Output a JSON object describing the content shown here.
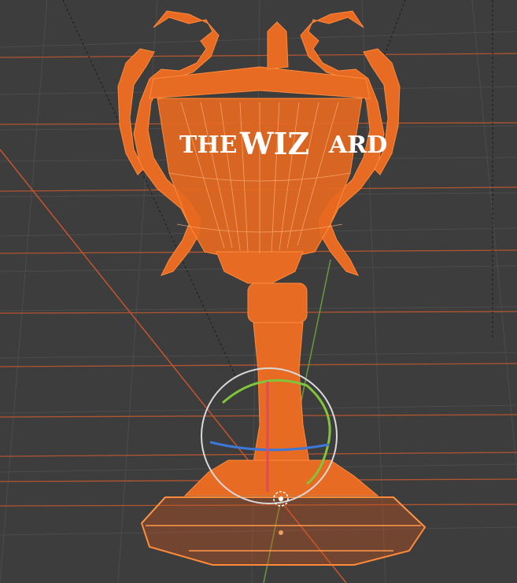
{
  "viewport": {
    "background": "#3d3d3d",
    "grid_color": "#4a4a4a",
    "x_axis_color": "#c6542e",
    "y_axis_color": "#6a9a3b",
    "selection_color": "#f26a1b"
  },
  "object": {
    "name": "trophy-cup",
    "engraving": {
      "left": "THE",
      "center": "WIZ",
      "right": "ARD"
    },
    "mode": "wireframe-selected"
  },
  "gizmo": {
    "type": "rotate",
    "ring_colors": {
      "x": "#e04a5c",
      "y": "#7fc63b",
      "z": "#3b78d8",
      "view": "#d9d9d9"
    },
    "pivot_icon": "3d-cursor-icon"
  }
}
